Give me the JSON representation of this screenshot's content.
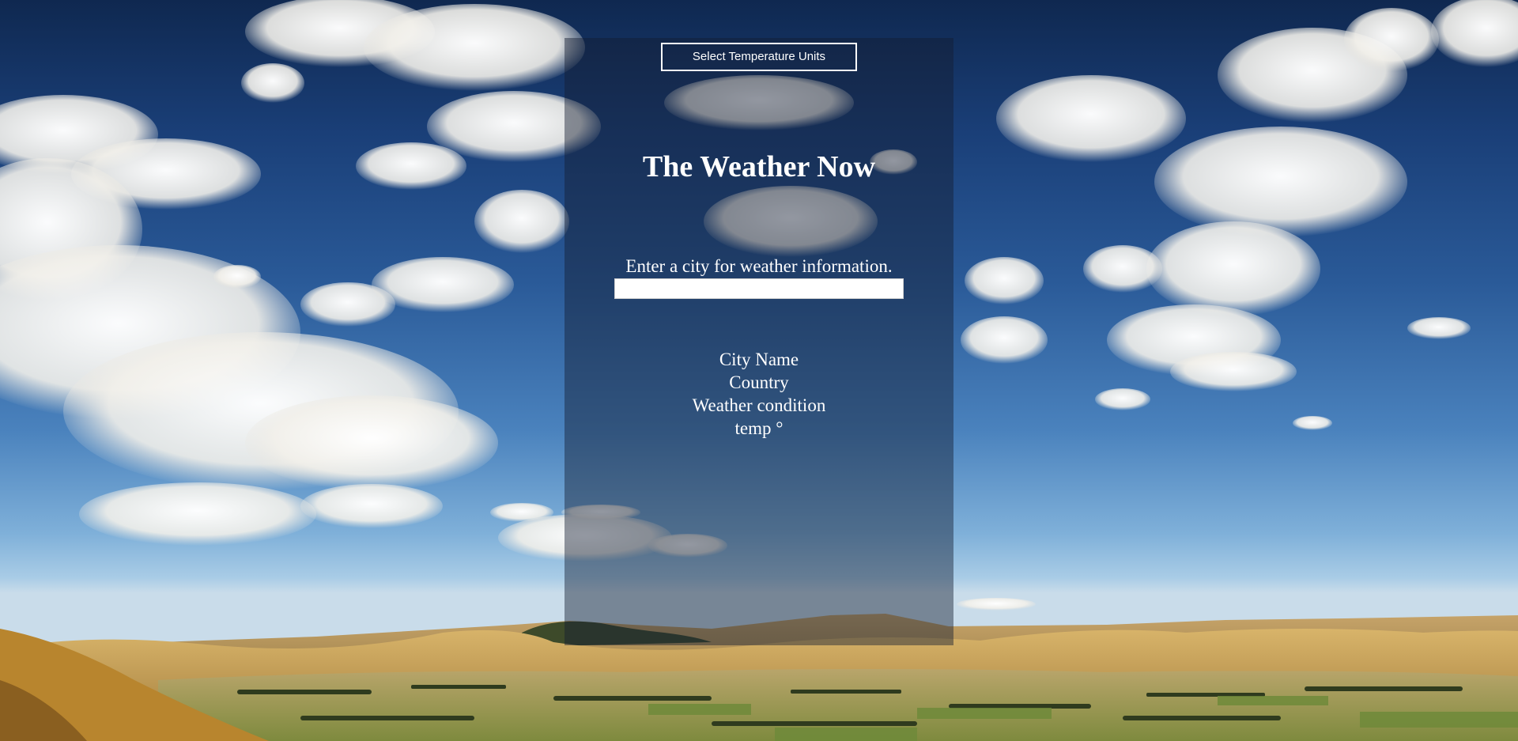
{
  "controls": {
    "units_button_label": "Select Temperature Units"
  },
  "header": {
    "title": "The Weather Now"
  },
  "search": {
    "prompt": "Enter a city for weather information.",
    "value": "",
    "placeholder": ""
  },
  "weather": {
    "city_name": "City Name",
    "country": "Country",
    "condition": "Weather condition",
    "temp": "temp °"
  },
  "colors": {
    "sky_top": "#0f2850",
    "sky_horizon": "#c9dcea",
    "hills": "#c9a257",
    "panel_overlay": "rgba(20, 28, 48, 0.45)",
    "text": "#ffffff"
  }
}
